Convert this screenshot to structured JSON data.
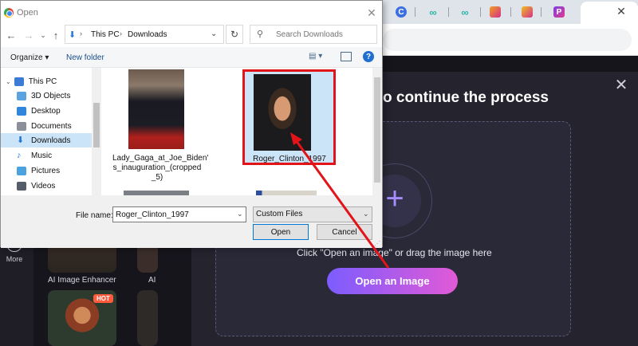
{
  "browser": {
    "tabs": [
      {
        "icon": "c-letter-icon",
        "color": "#3b6fe0"
      },
      {
        "icon": "infinity-icon",
        "color": "#2bb7a5"
      },
      {
        "icon": "infinity-icon",
        "color": "#2bb7a5"
      },
      {
        "icon": "gallery-icon",
        "color": "#f0a020"
      },
      {
        "icon": "gallery-icon",
        "color": "#d52e8a"
      },
      {
        "icon": "p-letter-icon",
        "color": "#c338e0"
      }
    ],
    "active_tab_close": "✕"
  },
  "webpage": {
    "modal_title": "o continue the process",
    "modal_close": "✕",
    "drop_hint": "Click \"Open an image\" or drag the image here",
    "open_image_button": "Open an Image",
    "more_label": "More",
    "thumb_label_enhancer": "AI Image Enhancer",
    "thumb_label_ai": "AI",
    "hot_badge": "HOT"
  },
  "dialog": {
    "title": "Open",
    "breadcrumb": [
      "This PC",
      "Downloads"
    ],
    "search_placeholder": "Search Downloads",
    "organize_label": "Organize ▾",
    "new_folder_label": "New folder",
    "help_label": "?",
    "nav_items": [
      {
        "label": "This PC",
        "icon": "pc-icon",
        "color": "#3a7bd5"
      },
      {
        "label": "3D Objects",
        "icon": "cube-icon",
        "color": "#5aa3e0"
      },
      {
        "label": "Desktop",
        "icon": "desktop-icon",
        "color": "#2e86de"
      },
      {
        "label": "Documents",
        "icon": "documents-icon",
        "color": "#8a8f99"
      },
      {
        "label": "Downloads",
        "icon": "download-arrow-icon",
        "color": "#1e74d6"
      },
      {
        "label": "Music",
        "icon": "music-icon",
        "color": "#2e86de"
      },
      {
        "label": "Pictures",
        "icon": "pictures-icon",
        "color": "#4aa3df"
      },
      {
        "label": "Videos",
        "icon": "videos-icon",
        "color": "#555d6a"
      }
    ],
    "files": [
      {
        "name": "Lady_Gaga_at_Joe_Biden's_inauguration_(cropped_5)",
        "lines": [
          "Lady_Gaga_at_Joe_Biden'",
          "s_inauguration_(cropped",
          "_5)"
        ]
      },
      {
        "name": "Roger_Clinton_1997",
        "lines": [
          "Roger_Clinton_1997"
        ]
      }
    ],
    "file_name_label": "File name:",
    "file_name_value": "Roger_Clinton_1997",
    "file_type_value": "Custom Files",
    "open_button": "Open",
    "cancel_button": "Cancel"
  },
  "annotation": {
    "color": "#e2141a"
  }
}
